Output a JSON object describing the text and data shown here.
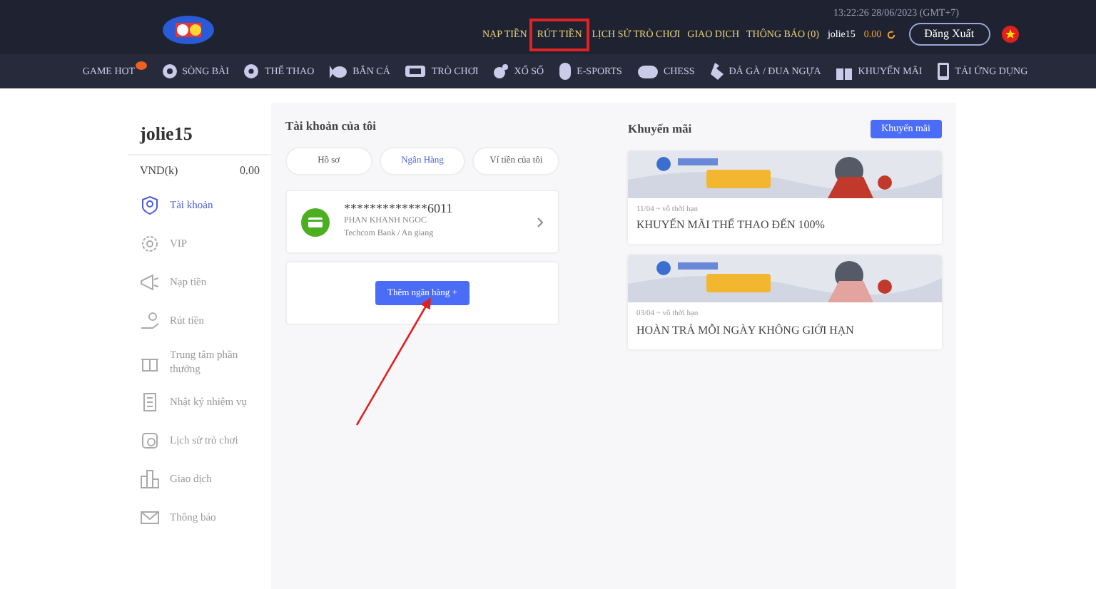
{
  "header": {
    "clock": "13:22:26 28/06/2023 (GMT+7)",
    "links": [
      {
        "label": "NẠP TIỀN",
        "highlighted": false
      },
      {
        "label": "RÚT TIỀN",
        "highlighted": true
      },
      {
        "label": "LỊCH SỬ TRÒ CHƠI",
        "highlighted": false
      },
      {
        "label": "GIAO DỊCH",
        "highlighted": false
      },
      {
        "label": "THÔNG BÁO (0)",
        "highlighted": false
      }
    ],
    "username": "jolie15",
    "balance": "0.00",
    "logout_button": "Đăng Xuất"
  },
  "nav": [
    {
      "label": "GAME HOT"
    },
    {
      "label": "SÒNG BÀI"
    },
    {
      "label": "THỂ THAO"
    },
    {
      "label": "BẮN CÁ"
    },
    {
      "label": "TRÒ CHƠI"
    },
    {
      "label": "XỔ SỐ"
    },
    {
      "label": "E-SPORTS"
    },
    {
      "label": "CHESS"
    },
    {
      "label": "ĐÁ GÀ / ĐUA NGỰA"
    },
    {
      "label": "KHUYẾN MÃI"
    },
    {
      "label": "TẢI ỨNG DỤNG"
    }
  ],
  "sidebar": {
    "username": "jolie15",
    "currency": "VND(k)",
    "amount": "0.00",
    "items": [
      {
        "label": "Tài khoản",
        "selected": true
      },
      {
        "label": "VIP",
        "selected": false
      },
      {
        "label": "Nạp tiền",
        "selected": false
      },
      {
        "label": "Rút tiền",
        "selected": false
      },
      {
        "label": "Trung tâm phần thưởng",
        "selected": false
      },
      {
        "label": "Nhật ký nhiệm vụ",
        "selected": false
      },
      {
        "label": "Lịch sử trò chơi",
        "selected": false
      },
      {
        "label": "Giao dịch",
        "selected": false
      },
      {
        "label": "Thông báo",
        "selected": false
      }
    ]
  },
  "account": {
    "title": "Tài khoản của tôi",
    "tabs": [
      {
        "label": "Hồ sơ",
        "selected": false
      },
      {
        "label": "Ngân Hàng",
        "selected": true
      },
      {
        "label": "Ví tiền của tôi",
        "selected": false
      }
    ],
    "bank_card": {
      "number": "*************6011",
      "holder": "PHAN KHANH NGOC",
      "bank": "Techcom Bank / An giang"
    },
    "add_button": "Thêm ngân hàng +"
  },
  "promotions": {
    "title": "Khuyến mãi",
    "button": "Khuyến mãi",
    "items": [
      {
        "kind": "picture",
        "date": "11/04 ~ vô thời hạn",
        "title": "KHUYẾN MÃI THỂ THAO ĐẾN 100%"
      },
      {
        "kind": "picture",
        "date": "03/04 ~ vô thời hạn",
        "title": "HOÀN TRẢ MỖI NGÀY KHÔNG GIỚI HẠN"
      }
    ]
  },
  "annotation_arrow": true
}
